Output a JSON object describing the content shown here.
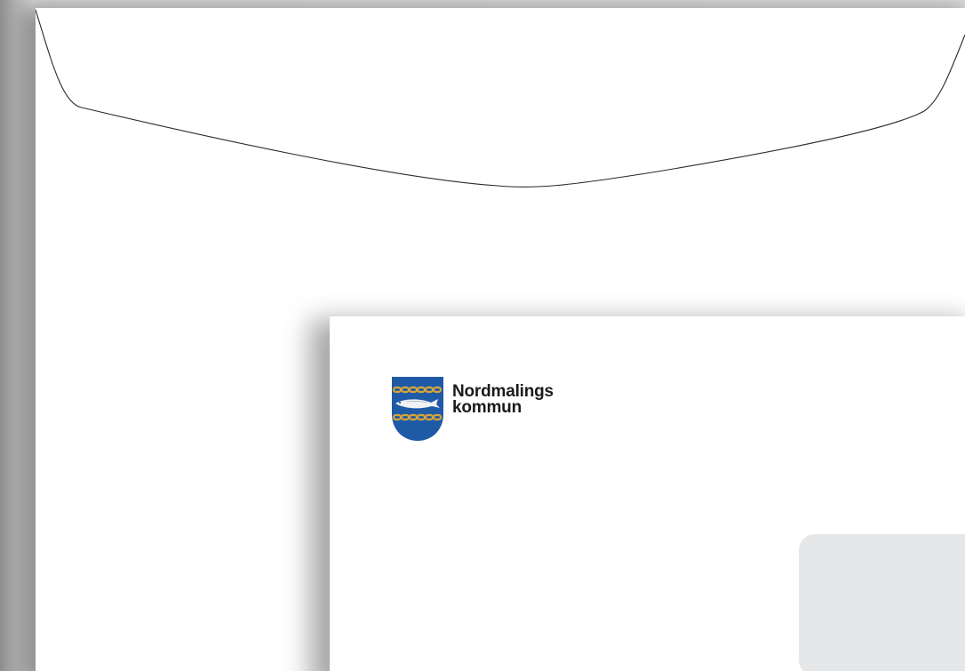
{
  "scene": "envelope-mockup",
  "brand": {
    "name_line1": "Nordmalings",
    "name_line2": "kommun",
    "colors": {
      "shield_blue": "#1f5aa6",
      "chain_gold": "#d6a437",
      "text": "#1a1a1a"
    },
    "icon": "coat-of-arms-pike-icon"
  },
  "address_window": {
    "color": "#e6e7e8"
  }
}
